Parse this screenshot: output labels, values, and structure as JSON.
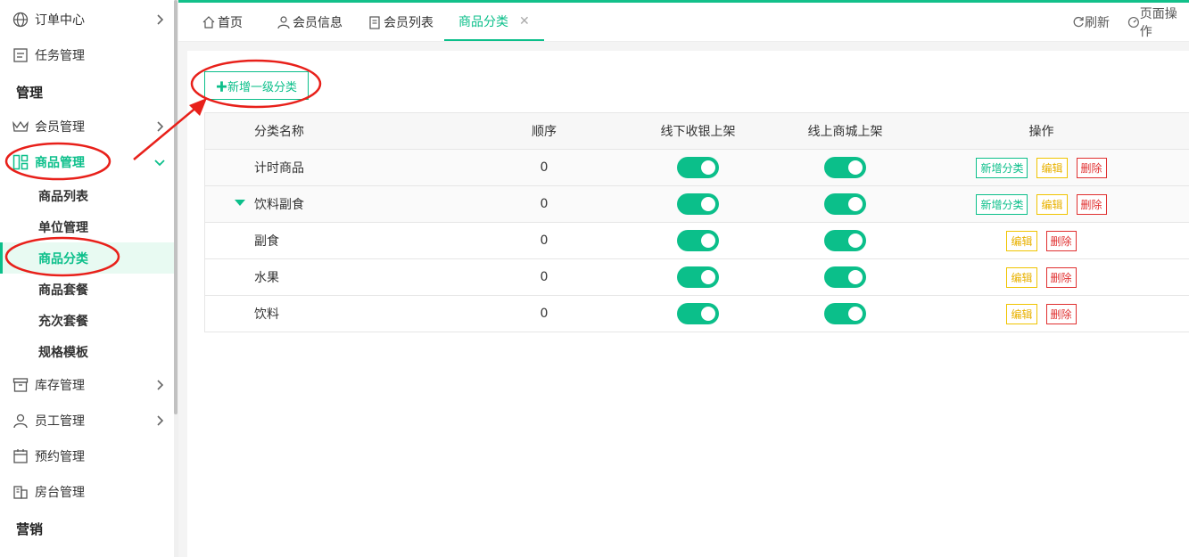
{
  "sidebar": {
    "items": [
      {
        "label": "订单中心",
        "icon": "globe-icon"
      },
      {
        "label": "任务管理",
        "icon": "task-icon"
      },
      {
        "label": "会员管理",
        "icon": "crown-icon"
      },
      {
        "label": "商品管理",
        "icon": "grid-icon"
      },
      {
        "label": "库存管理",
        "icon": "archive-icon"
      },
      {
        "label": "员工管理",
        "icon": "user-icon"
      },
      {
        "label": "预约管理",
        "icon": "calendar-icon"
      },
      {
        "label": "房台管理",
        "icon": "building-icon"
      }
    ],
    "sections": {
      "manage": "管理",
      "marketing": "营销"
    },
    "goods_sub": [
      "商品列表",
      "单位管理",
      "商品分类",
      "商品套餐",
      "充次套餐",
      "规格模板"
    ]
  },
  "tabs": [
    {
      "label": "首页",
      "icon": "home-icon"
    },
    {
      "label": "会员信息",
      "icon": "user-icon"
    },
    {
      "label": "会员列表",
      "icon": "clipboard-icon"
    },
    {
      "label": "商品分类",
      "close": "✕"
    }
  ],
  "toolbar": {
    "refresh": "刷新",
    "page_ops": "页面操作"
  },
  "add_button": "✚新增一级分类",
  "table": {
    "headers": [
      "分类名称",
      "顺序",
      "线下收银上架",
      "线上商城上架",
      "操作"
    ],
    "rows": [
      {
        "name": "计时商品",
        "order": "0",
        "offline": true,
        "online": true,
        "ops": [
          "新增分类",
          "编辑",
          "删除"
        ]
      },
      {
        "name": "饮料副食",
        "order": "0",
        "offline": true,
        "online": true,
        "ops": [
          "新增分类",
          "编辑",
          "删除"
        ],
        "expanded": true
      },
      {
        "name": "副食",
        "order": "0",
        "offline": true,
        "online": true,
        "ops": [
          "编辑",
          "删除"
        ]
      },
      {
        "name": "水果",
        "order": "0",
        "offline": true,
        "online": true,
        "ops": [
          "编辑",
          "删除"
        ]
      },
      {
        "name": "饮料",
        "order": "0",
        "offline": true,
        "online": true,
        "ops": [
          "编辑",
          "删除"
        ]
      }
    ]
  },
  "colors": {
    "accent": "#0bbf8a",
    "edit": "#e8b100",
    "delete": "#e03030",
    "annotation": "#e8201a"
  }
}
